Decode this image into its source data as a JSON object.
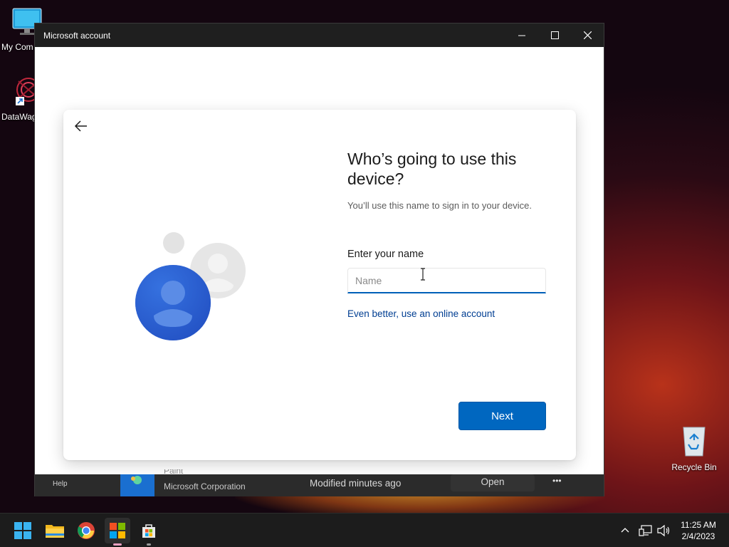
{
  "desktop": {
    "icons": [
      {
        "label": "My Com"
      },
      {
        "label": "DataWag"
      },
      {
        "label": "Recycle Bin"
      }
    ]
  },
  "window": {
    "title": "Microsoft account"
  },
  "dialog": {
    "heading": "Who’s going to use this device?",
    "subtext": "You’ll use this name to sign in to your device.",
    "name_label": "Enter your name",
    "name_value": "",
    "name_placeholder": "Name",
    "online_link": "Even better, use an online account",
    "next_label": "Next"
  },
  "background_strip": {
    "help": "Help",
    "app_name": "Paint",
    "publisher": "Microsoft Corporation",
    "modified": "Modified minutes ago",
    "open_label": "Open",
    "more": "•••"
  },
  "taskbar": {
    "apps": [
      "start-icon",
      "file-explorer-icon",
      "chrome-icon",
      "microsoft-store-icon",
      "store-bag-icon"
    ],
    "clock": {
      "time": "11:25 AM",
      "date": "2/4/2023"
    }
  },
  "colors": {
    "accent": "#0067c0",
    "link": "#003e92"
  }
}
